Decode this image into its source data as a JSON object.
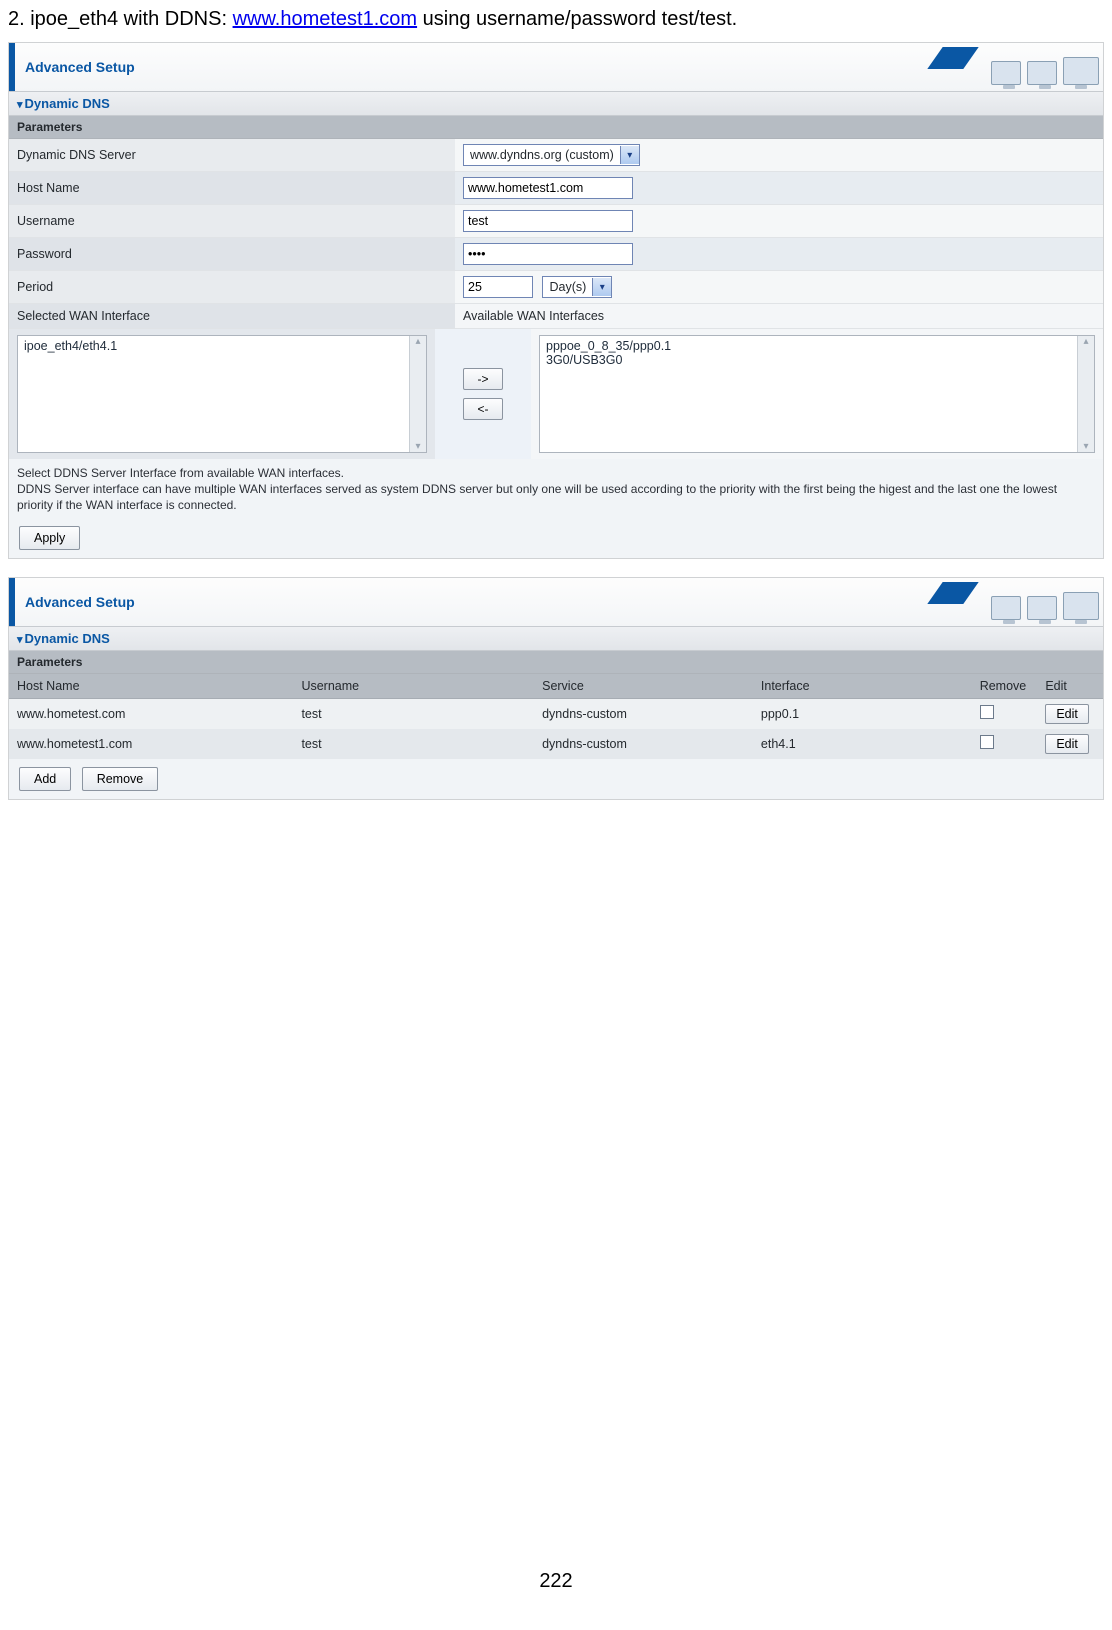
{
  "intro": {
    "prefix": "2. ipoe_eth4 with DDNS: ",
    "link": "www.hometest1.com",
    "suffix": " using username/password test/test."
  },
  "panel1": {
    "title": "Advanced Setup",
    "section": "Dynamic DNS",
    "parameters_label": "Parameters",
    "rows": {
      "ddns_server_label": "Dynamic DNS Server",
      "ddns_server_value": "www.dyndns.org (custom)",
      "host_label": "Host Name",
      "host_value": "www.hometest1.com",
      "user_label": "Username",
      "user_value": "test",
      "pass_label": "Password",
      "pass_value": "••••",
      "period_label": "Period",
      "period_value": "25",
      "period_unit": "Day(s)",
      "selected_wan_label": "Selected WAN Interface",
      "available_wan_label": "Available WAN Interfaces"
    },
    "selected_wan_items": "ipoe_eth4/eth4.1",
    "available_wan_items": "pppoe_0_8_35/ppp0.1\n3G0/USB3G0",
    "move_right": "->",
    "move_left": "<-",
    "help1": "Select DDNS Server Interface from available WAN interfaces.",
    "help2": "DDNS Server interface can have multiple WAN interfaces served as system DDNS server but only one will be used according to the priority with the first being the higest and the last one the lowest priority if the WAN interface is connected.",
    "apply": "Apply"
  },
  "panel2": {
    "title": "Advanced Setup",
    "section": "Dynamic DNS",
    "parameters_label": "Parameters",
    "cols": {
      "host": "Host Name",
      "user": "Username",
      "service": "Service",
      "iface": "Interface",
      "remove": "Remove",
      "edit": "Edit"
    },
    "rows": [
      {
        "host": "www.hometest.com",
        "user": "test",
        "service": "dyndns-custom",
        "iface": "ppp0.1",
        "edit": "Edit"
      },
      {
        "host": "www.hometest1.com",
        "user": "test",
        "service": "dyndns-custom",
        "iface": "eth4.1",
        "edit": "Edit"
      }
    ],
    "add": "Add",
    "remove": "Remove"
  },
  "page_number": "222"
}
